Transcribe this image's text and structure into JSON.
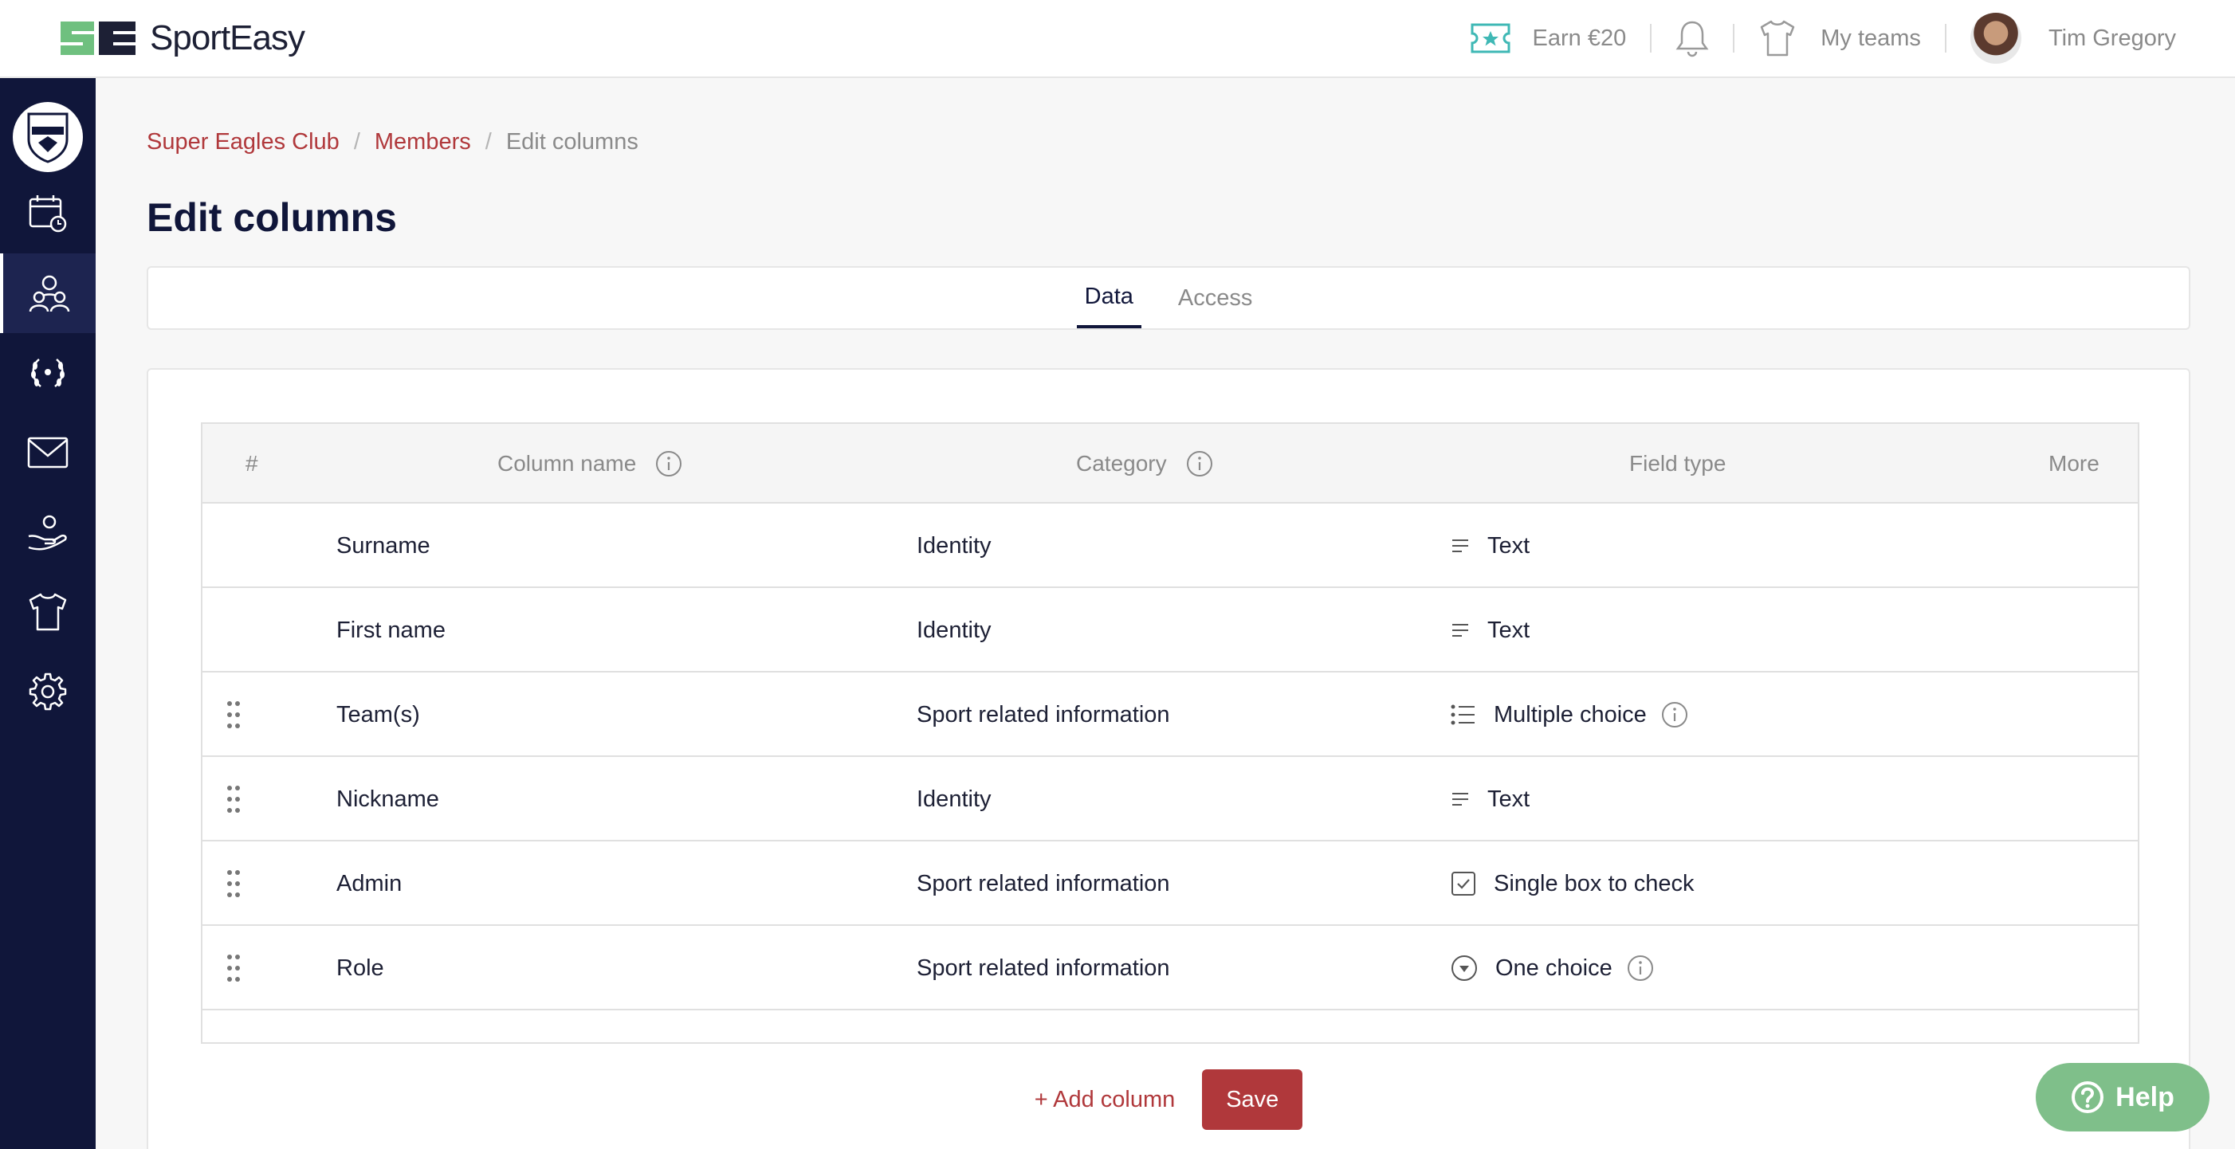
{
  "brand": {
    "name": "SportEasy",
    "mark": "SE",
    "accent": "#b0383b",
    "nav_bg": "#10163a"
  },
  "header": {
    "earn_label": "Earn €20",
    "my_teams_label": "My teams",
    "user_name": "Tim Gregory"
  },
  "sidebar": {
    "items": [
      {
        "name": "calendar-icon"
      },
      {
        "name": "members-icon",
        "active": true
      },
      {
        "name": "trophy-icon"
      },
      {
        "name": "mail-icon"
      },
      {
        "name": "helping-hand-icon"
      },
      {
        "name": "jersey-icon"
      },
      {
        "name": "gear-icon"
      }
    ]
  },
  "breadcrumb": {
    "club": "Super Eagles Club",
    "members": "Members",
    "current": "Edit columns",
    "separator": "/"
  },
  "page": {
    "title": "Edit columns"
  },
  "tabs": [
    {
      "label": "Data",
      "active": true
    },
    {
      "label": "Access",
      "active": false
    }
  ],
  "table": {
    "headers": {
      "index": "#",
      "column_name": "Column name",
      "category": "Category",
      "field_type": "Field type",
      "more": "More"
    },
    "rows": [
      {
        "name": "Surname",
        "category": "Identity",
        "field_type": "Text",
        "field_icon": "text-lines-icon",
        "draggable": false
      },
      {
        "name": "First name",
        "category": "Identity",
        "field_type": "Text",
        "field_icon": "text-lines-icon",
        "draggable": false
      },
      {
        "name": "Team(s)",
        "category": "Sport related information",
        "field_type": "Multiple choice",
        "field_icon": "list-icon",
        "draggable": true,
        "info": true
      },
      {
        "name": "Nickname",
        "category": "Identity",
        "field_type": "Text",
        "field_icon": "text-lines-icon",
        "draggable": true
      },
      {
        "name": "Admin",
        "category": "Sport related information",
        "field_type": "Single box to check",
        "field_icon": "checkbox-icon",
        "draggable": true
      },
      {
        "name": "Role",
        "category": "Sport related information",
        "field_type": "One choice",
        "field_icon": "dropdown-circle-icon",
        "draggable": true,
        "info": true
      }
    ]
  },
  "actions": {
    "add_column": "+ Add column",
    "save": "Save"
  },
  "help": {
    "label": "Help"
  }
}
